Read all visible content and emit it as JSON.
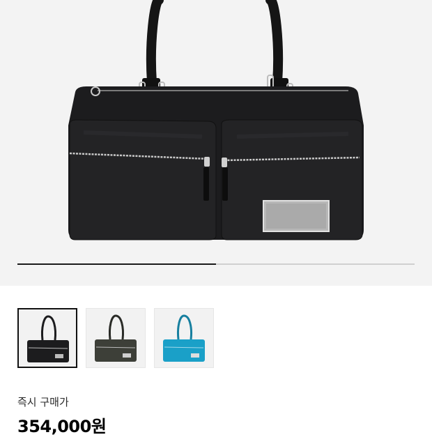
{
  "gallery": {
    "progress": 0.5,
    "thumbnails": [
      {
        "color_name": "black",
        "body": "#1c1c1e",
        "selected": true
      },
      {
        "color_name": "olive-gray",
        "body": "#3d3f38",
        "selected": false
      },
      {
        "color_name": "teal-blue",
        "body": "#1aa0c8",
        "selected": false
      }
    ]
  },
  "product": {
    "price_label": "즉시 구매가",
    "price_value": "354,000원"
  },
  "colors": {
    "hero_bg": "#f3f3f3",
    "bag_black": "#1c1c1e",
    "zipper_silver": "#c9c9c9"
  }
}
